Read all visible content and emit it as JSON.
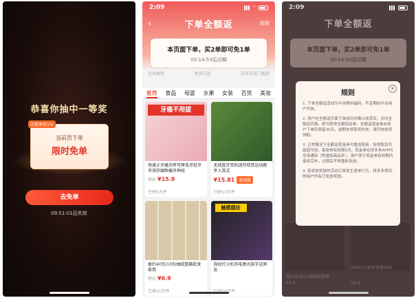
{
  "screen1": {
    "congrats": "恭喜你抽中一等奖",
    "tag": "中奖率仅1%",
    "prize_sub": "当前页下单",
    "prize_main": "限时免单",
    "button": "去免单",
    "timer": "09:51:01后失效"
  },
  "screen2": {
    "status_time": "2:09",
    "nav_title": "下单全额返",
    "nav_rule": "规则",
    "promo_title": "本页面下单，买2单即可免1单",
    "promo_time": "00:14:53后过期",
    "steps": [
      "全场抽单",
      "收货立返",
      "送多张无门槛券"
    ],
    "categories": [
      "推荐",
      "食品",
      "母婴",
      "水果",
      "女装",
      "百货",
      "美妆"
    ],
    "products": [
      {
        "banner": "牙痛不用拔",
        "title": "快速止牙痛牙疼可摔虫牙蛀牙牙洞牙龈肿痛牙神经",
        "orig": "特价",
        "price": "¥15.9",
        "sold": "已拼5万件"
      },
      {
        "banner": "",
        "title": "无线蓝牙耳机迷你双耳运动跑步入耳式",
        "orig": "",
        "price": "¥15.81",
        "buy": "去抢购",
        "sold": "已拼10万件"
      },
      {
        "banner": "",
        "title": "香约40包/10包抽纸整箱批发家用",
        "orig": "特价",
        "price": "¥6.9",
        "sold": "已拼10万件"
      },
      {
        "banner": "触摸感应",
        "title": "指纹打火机充电激光刻字送男友",
        "orig": "",
        "price": "",
        "sold": "已拼10万件"
      }
    ]
  },
  "screen3": {
    "status_time": "2:09",
    "bg_title": "下单全额返",
    "bg_promo_title": "本页面下单，买2单即可免1单",
    "bg_promo_time": "00:14:50后过期",
    "modal_title": "规则",
    "rules": [
      "1. 下单全额返活动为平台限时福利，不定期向平台用户开放。",
      "2. 用户在全额返页面下单成功并确认收货后，访问全额返页面，即可获得全额现金券。全额返现金券自用户下单后保留30天，逾期未领取将失效，请尽快收货领取。",
      "3. 正常情况下全额返现金券可叠加使用，但领取后可能因可用，每张券有效期3天。现金券在拼多多APP内全场通用（除虚拟商品外），用户须于现金券有效期内使用完毕，过期后不再重新发放。",
      "4. 若发放奖励的活动订单发生退单行为，拼多多将扣除用户内有已发放奖励。"
    ],
    "bg_items": [
      "香约40包10层抽纸整箱",
      "指纹打火机充电激光刻",
      "¥6.9",
      "¥8.9"
    ]
  },
  "icons": [
    "back-arrow-icon",
    "close-icon",
    "signal-icon",
    "wifi-icon",
    "battery-icon"
  ],
  "colors": {
    "accent": "#e3342a",
    "gold": "#f7e1b0",
    "header": "#f05b5b"
  }
}
